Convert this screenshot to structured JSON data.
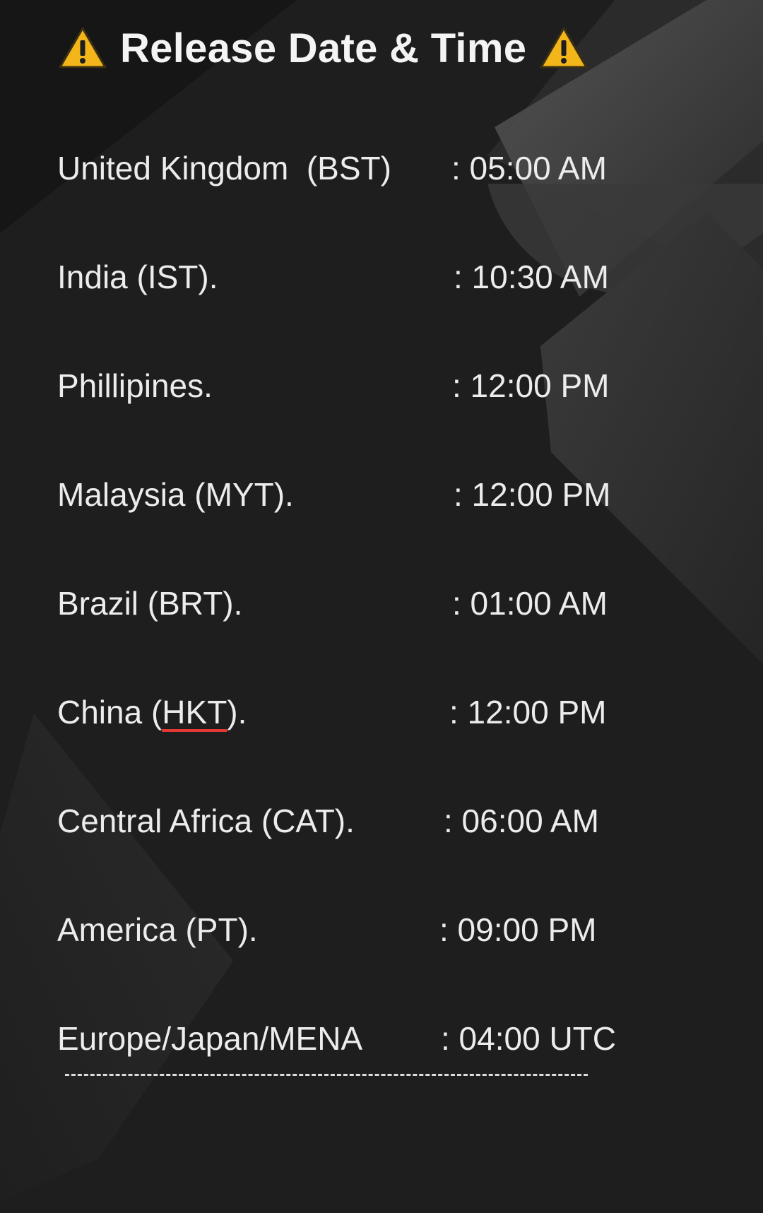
{
  "header": {
    "title": "Release Date & Time",
    "left_icon": "warning-icon",
    "right_icon": "warning-icon",
    "icon_color": "#f2b61b"
  },
  "schedule": [
    {
      "region": "United Kingdom  (BST)",
      "time": ": 05:00 AM"
    },
    {
      "region": "India (IST).",
      "time": ": 10:30 AM"
    },
    {
      "region": "Phillipines.",
      "time": ": 12:00 PM"
    },
    {
      "region": "Malaysia (MYT).",
      "time": ": 12:00 PM"
    },
    {
      "region": "Brazil (BRT).",
      "time": ": 01:00 AM"
    },
    {
      "region_prefix": "China (",
      "region_flagged": "HKT",
      "region_suffix": ").",
      "time": ": 12:00 PM"
    },
    {
      "region": "Central Africa (CAT).",
      "time": ": 06:00 AM"
    },
    {
      "region": "America (PT).",
      "time": ": 09:00 PM"
    },
    {
      "region": "Europe/Japan/MENA",
      "time": ": 04:00 UTC"
    }
  ],
  "colors": {
    "background": "#1f1f1f",
    "text": "#ececec",
    "spellcheck_underline": "#e53935"
  }
}
